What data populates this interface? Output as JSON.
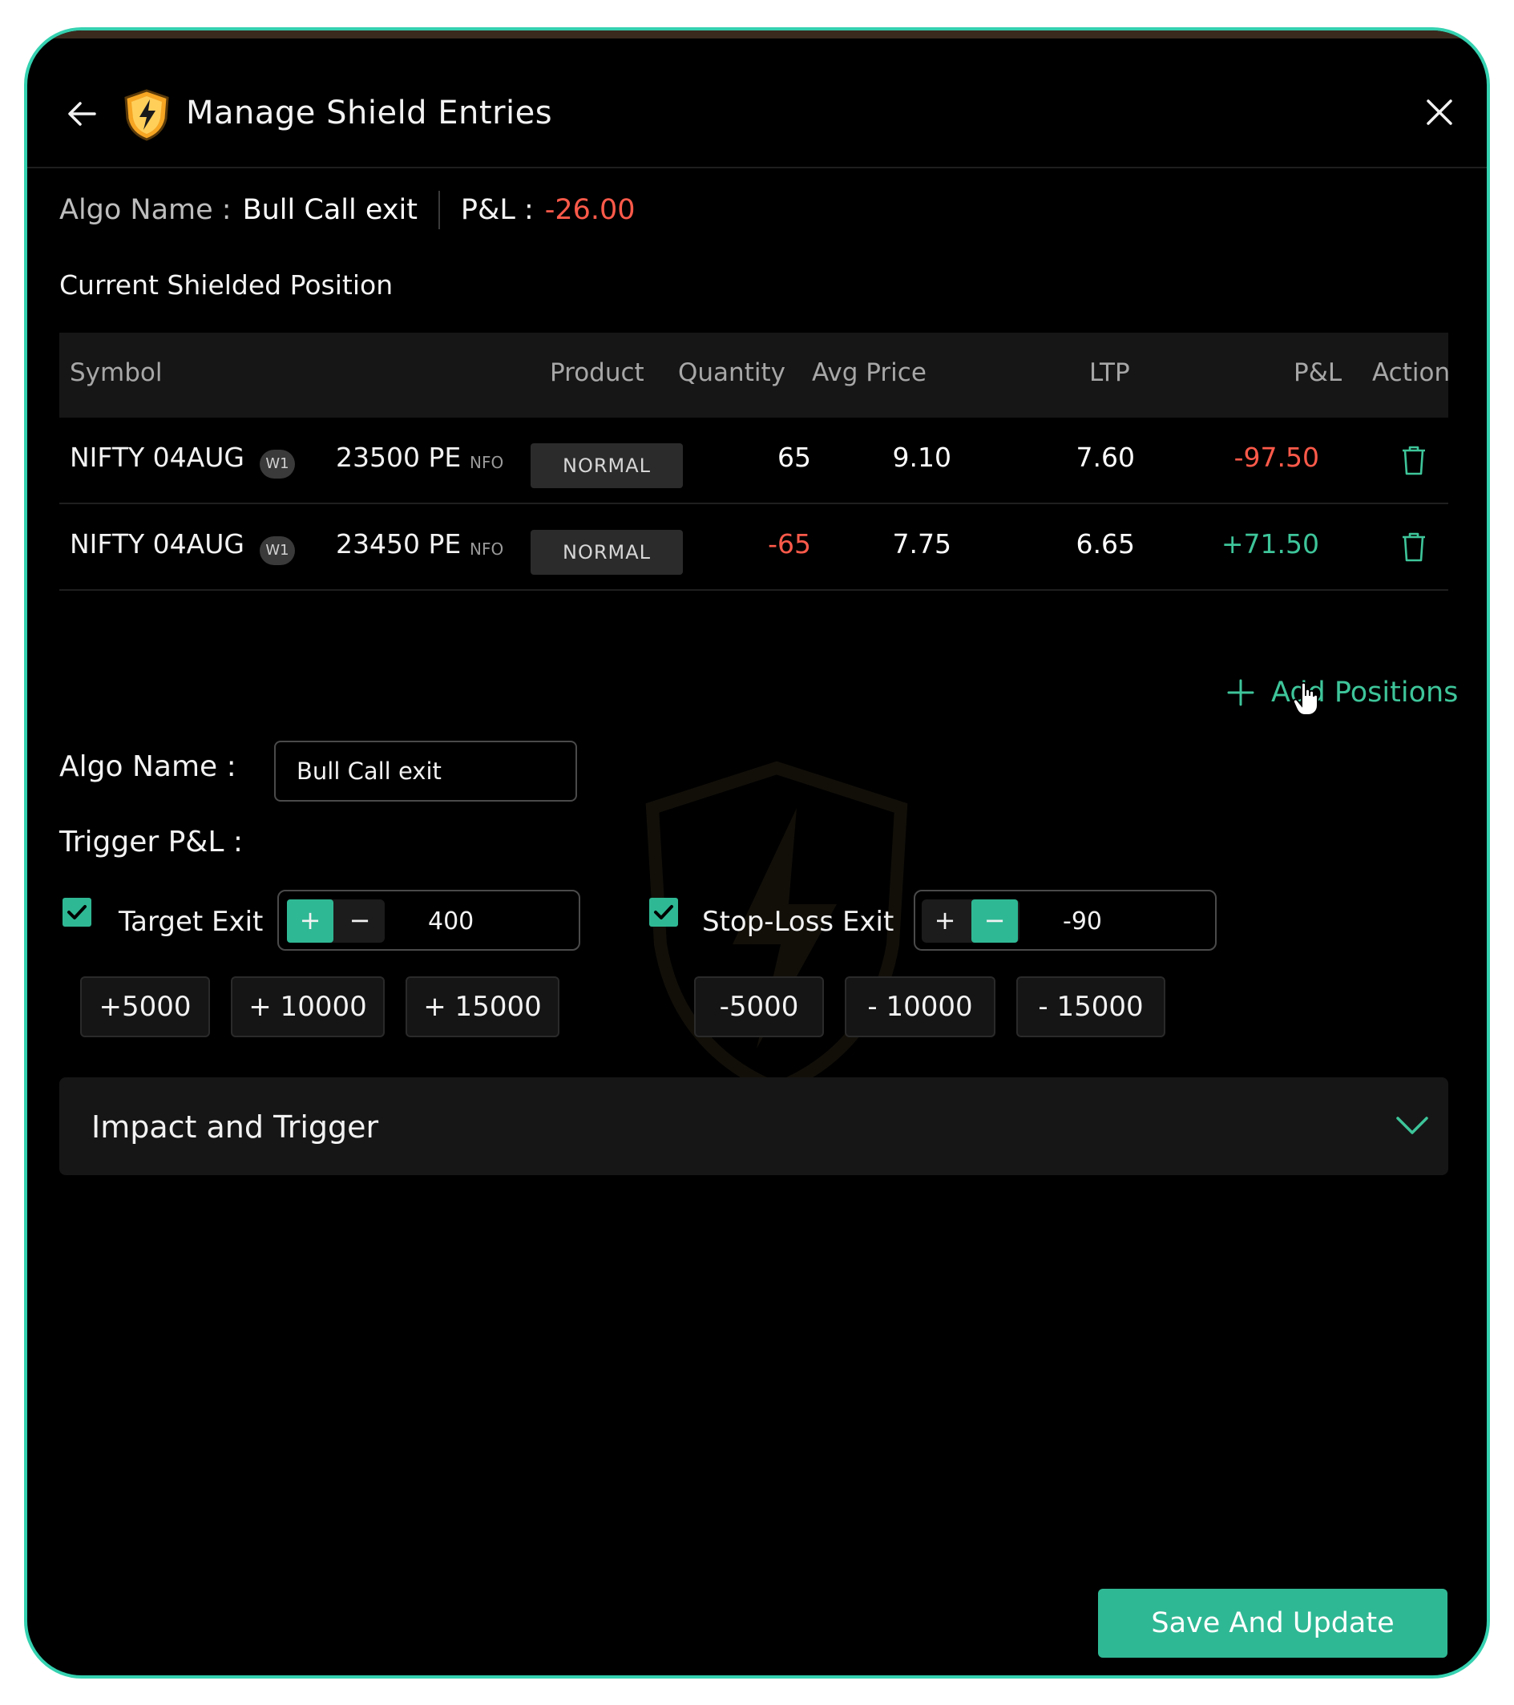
{
  "header": {
    "title": "Manage Shield Entries"
  },
  "summary": {
    "algo_label": "Algo Name :",
    "algo_value": "Bull Call exit",
    "pnl_label": "P&L :",
    "pnl_value": "-26.00"
  },
  "section": {
    "title": "Current Shielded Position"
  },
  "table": {
    "columns": [
      "Symbol",
      "Product",
      "Quantity",
      "Avg Price",
      "LTP",
      "P&L",
      "Action"
    ],
    "rows": [
      {
        "symbol": "NIFTY 04AUG",
        "badge": "W1",
        "strike": "23500 PE",
        "exchange": "NFO",
        "product": "NORMAL",
        "quantity": "65",
        "avg_price": "9.10",
        "ltp": "7.60",
        "pnl": "-97.50"
      },
      {
        "symbol": "NIFTY 04AUG",
        "badge": "W1",
        "strike": "23450 PE",
        "exchange": "NFO",
        "product": "NORMAL",
        "quantity": "-65",
        "avg_price": "7.75",
        "ltp": "6.65",
        "pnl": "+71.50"
      }
    ]
  },
  "add_positions": {
    "label": "Add Positions"
  },
  "form": {
    "algo_name_label": "Algo Name :",
    "algo_name_value": "Bull Call exit",
    "trigger_label": "Trigger P&L :",
    "target": {
      "label": "Target Exit",
      "checked": true,
      "plus": "+",
      "minus": "−",
      "value": "400",
      "active": "plus",
      "quick": [
        "+5000",
        "+ 10000",
        "+ 15000"
      ]
    },
    "stoploss": {
      "label": "Stop-Loss Exit",
      "checked": true,
      "plus": "+",
      "minus": "−",
      "value": "-90",
      "active": "minus",
      "quick": [
        "-5000",
        "- 10000",
        "- 15000"
      ]
    }
  },
  "accordion": {
    "title": "Impact and Trigger",
    "icon": "chevron-down-icon"
  },
  "footer": {
    "save_label": "Save And Update"
  },
  "colors": {
    "accent": "#2fb894",
    "negative": "#ff5a4a",
    "positive": "#3ec59a",
    "frame": "#35d1b0"
  }
}
